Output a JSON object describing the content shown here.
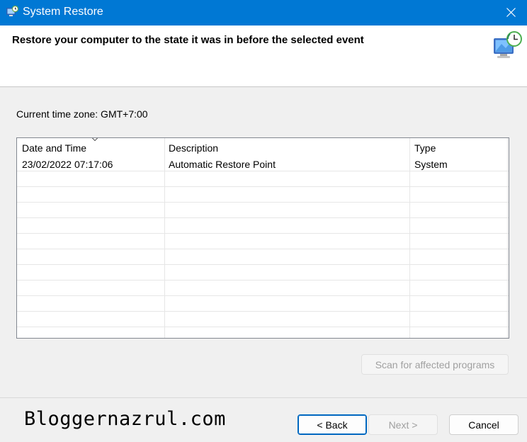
{
  "window": {
    "title": "System Restore",
    "accent": "#0078d4",
    "icon": "system-restore-icon",
    "close_icon": "close-icon"
  },
  "header": {
    "instruction": "Restore your computer to the state it was in before the selected event",
    "icon": "restore-monitor-clock-icon"
  },
  "timezone_label": "Current time zone: GMT+7:00",
  "table": {
    "columns": [
      "Date and Time",
      "Description",
      "Type"
    ],
    "sort_icon": "sort-chevron-icon",
    "rows": [
      {
        "date": "23/02/2022 07:17:06",
        "description": "Automatic Restore Point",
        "type": "System"
      }
    ]
  },
  "buttons": {
    "scan": "Scan for affected programs",
    "back": "< Back",
    "next": "Next >",
    "cancel": "Cancel"
  },
  "watermark": "Bloggernazrul.com"
}
